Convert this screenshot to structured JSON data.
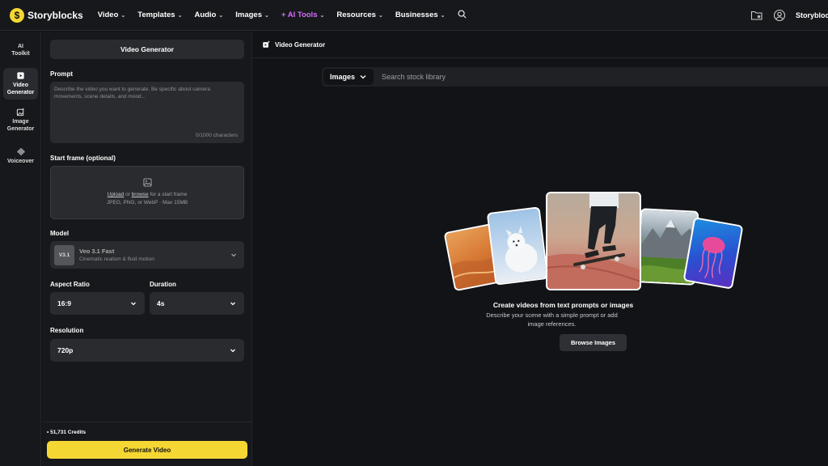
{
  "app": {
    "logo_text": "Storyblocks",
    "logo_glyph": "$"
  },
  "nav": {
    "items": [
      {
        "label": "Video"
      },
      {
        "label": "Templates"
      },
      {
        "label": "Audio"
      },
      {
        "label": "Images"
      },
      {
        "label": "+ AI Tools"
      },
      {
        "label": "Resources"
      },
      {
        "label": "Businesses"
      }
    ],
    "user_name": "Storyblocks"
  },
  "rail": {
    "items": [
      {
        "label": "AI Toolkit"
      },
      {
        "label": "Video Generator"
      },
      {
        "label": "Image Generator"
      },
      {
        "label": "Voiceover"
      }
    ]
  },
  "panel": {
    "title": "Video Generator",
    "prompt_label": "Prompt",
    "prompt_placeholder": "Describe the video you want to generate. Be specific about camera movements, scene details, and mood...",
    "prompt_count": "0/1000 characters",
    "start_frame_label": "Start frame (optional)",
    "upload_link": "Upload",
    "upload_or": "or",
    "browse_link": "browse",
    "upload_suffix": "for a start frame",
    "upload_formats": "JPEG, PNG, or WebP · Max 15MB",
    "model_label": "Model",
    "model_badge": "V3.1",
    "model_name": "Veo 3.1 Fast",
    "model_desc": "Cinematic realism & fluid motion",
    "aspect_label": "Aspect Ratio",
    "aspect_value": "16:9",
    "duration_label": "Duration",
    "duration_value": "4s",
    "resolution_label": "Resolution",
    "resolution_value": "720p",
    "credits": "• 51,731 Credits",
    "generate_label": "Generate Video"
  },
  "main": {
    "title": "Video Generator",
    "search_type": "Images",
    "search_placeholder": "Search stock library",
    "empty_title": "Create videos from text prompts or images",
    "empty_desc_1": "Describe your scene with a simple prompt or add",
    "empty_desc_2": "image references.",
    "browse_label": "Browse Images"
  },
  "colors": {
    "accent": "#f5d733",
    "ai_tools": "#d96bff",
    "background": "#121316",
    "panel": "#17181b"
  }
}
